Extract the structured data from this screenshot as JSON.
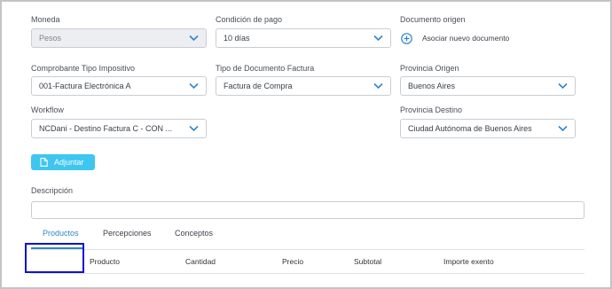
{
  "form": {
    "moneda": {
      "label": "Moneda",
      "value": "Pesos"
    },
    "condicion_pago": {
      "label": "Condición de pago",
      "value": "10 días"
    },
    "documento_origen": {
      "label": "Documento origen",
      "action": "Asociar nuevo documento"
    },
    "comprobante": {
      "label": "Comprobante Tipo Impositivo",
      "value": "001-Factura Electrónica A"
    },
    "tipo_documento": {
      "label": "Tipo de Documento Factura",
      "value": "Factura de Compra"
    },
    "provincia_origen": {
      "label": "Provincia Origen",
      "value": "Buenos Aires"
    },
    "workflow": {
      "label": "Workflow",
      "value": "NCDani - Destino Factura C - CON ..."
    },
    "provincia_destino": {
      "label": "Provincia Destino",
      "value": "Ciudad Autónoma de Buenos Aires"
    },
    "adjuntar_label": "Adjuntar",
    "descripcion": {
      "label": "Descripción",
      "value": ""
    }
  },
  "tabs": [
    {
      "label": "Productos",
      "active": true
    },
    {
      "label": "Percepciones",
      "active": false
    },
    {
      "label": "Conceptos",
      "active": false
    }
  ],
  "table": {
    "columns": [
      "Producto",
      "Cantidad",
      "Precio",
      "Subtotal",
      "Importe exento"
    ]
  },
  "colors": {
    "accent": "#2f86c8",
    "button": "#3ec6f0",
    "highlight_box": "#1010d0"
  },
  "icons": {
    "chevron": "chevron-down-icon",
    "add": "plus-circle-icon",
    "attach": "file-icon"
  }
}
